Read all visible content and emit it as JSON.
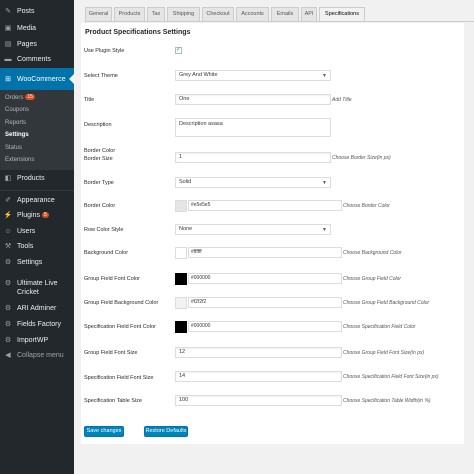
{
  "sidebar": {
    "items": [
      {
        "icon": "pin-icon",
        "label": "Posts"
      },
      {
        "icon": "media-icon",
        "label": "Media"
      },
      {
        "icon": "pages-icon",
        "label": "Pages"
      },
      {
        "icon": "comments-icon",
        "label": "Comments"
      },
      {
        "icon": "woocommerce-icon",
        "label": "WooCommerce"
      },
      {
        "icon": "products-icon",
        "label": "Products"
      },
      {
        "icon": "appearance-icon",
        "label": "Appearance"
      },
      {
        "icon": "plugins-icon",
        "label": "Plugins",
        "badge": "5"
      },
      {
        "icon": "users-icon",
        "label": "Users"
      },
      {
        "icon": "tools-icon",
        "label": "Tools"
      },
      {
        "icon": "settings-icon",
        "label": "Settings"
      },
      {
        "icon": "cricket-icon",
        "label": "Ultimate Live Cricket"
      },
      {
        "icon": "ari-icon",
        "label": "ARI Adminer"
      },
      {
        "icon": "fields-icon",
        "label": "Fields Factory"
      },
      {
        "icon": "import-icon",
        "label": "ImportWP"
      },
      {
        "icon": "collapse-icon",
        "label": "Collapse menu"
      }
    ],
    "woocommerce_submenu": [
      {
        "label": "Orders",
        "badge": "15"
      },
      {
        "label": "Coupons"
      },
      {
        "label": "Reports"
      },
      {
        "label": "Settings",
        "current": true
      },
      {
        "label": "Status"
      },
      {
        "label": "Extensions"
      }
    ]
  },
  "tabs": [
    "General",
    "Products",
    "Tax",
    "Shipping",
    "Checkout",
    "Accounts",
    "Emails",
    "API",
    "Specifications"
  ],
  "active_tab": "Specifications",
  "section_title": "Product Specifications Settings",
  "form": {
    "use_plugin_style": {
      "label": "Use Plugin Style",
      "checked": true
    },
    "select_theme": {
      "label": "Select Theme",
      "value": "Grey And White"
    },
    "title": {
      "label": "Title",
      "value": "One",
      "desc": "Add Title"
    },
    "description": {
      "label": "Description",
      "value": "Description asasa"
    },
    "border_color_label": "Border Color",
    "border_size": {
      "label": "Border Size",
      "value": "1",
      "desc": "Choose Border Size(in px)"
    },
    "border_type": {
      "label": "Border Type",
      "value": "Solid"
    },
    "border_color": {
      "label": "Border Color",
      "value": "#e5e5e5",
      "desc": "Choose Border Color"
    },
    "row_color_style": {
      "label": "Row Color Style",
      "value": "None"
    },
    "background_color": {
      "label": "Background Color",
      "value": "#ffffff",
      "desc": "Choose Background Color"
    },
    "group_field_font_color": {
      "label": "Group Field Font Color",
      "value": "#000000",
      "desc": "Choose Group Field Color"
    },
    "group_field_bg_color": {
      "label": "Group Field Background Color",
      "value": "#f2f2f2",
      "desc": "Choose Group Field Background Color"
    },
    "spec_field_font_color": {
      "label": "Specification Field Font Color",
      "value": "#000000",
      "desc": "Choose Specification Field Color"
    },
    "group_field_font_size": {
      "label": "Group Field Font Size",
      "value": "12",
      "desc": "Choose Group Field Font Size(in px)"
    },
    "spec_field_font_size": {
      "label": "Specification Field Font Size",
      "value": "14",
      "desc": "Choose Specification Field Font Size(in px)"
    },
    "spec_table_size": {
      "label": "Specification Table Size",
      "value": "100",
      "desc": "Choose Specification Table Width(in %)"
    }
  },
  "buttons": {
    "save": "Save changes",
    "restore": "Restore Defaults"
  },
  "colors": {
    "sidebar_bg": "#23282d",
    "accent": "#0073aa",
    "button": "#0085ba"
  }
}
